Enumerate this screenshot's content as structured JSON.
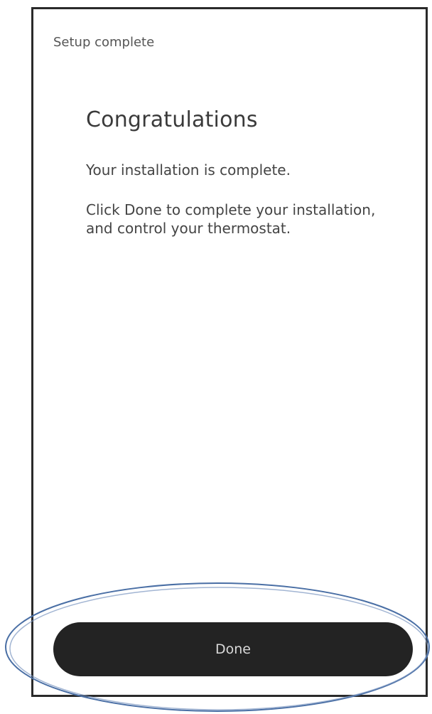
{
  "screen": {
    "header_title": "Setup complete",
    "heading": "Congratulations",
    "message": "Your installation is complete.",
    "instruction": "Click Done to complete your installation, and control your thermostat."
  },
  "footer": {
    "done_label": "Done"
  },
  "colors": {
    "button_bg": "#232323",
    "highlight_ring": "#4a6fa5"
  }
}
